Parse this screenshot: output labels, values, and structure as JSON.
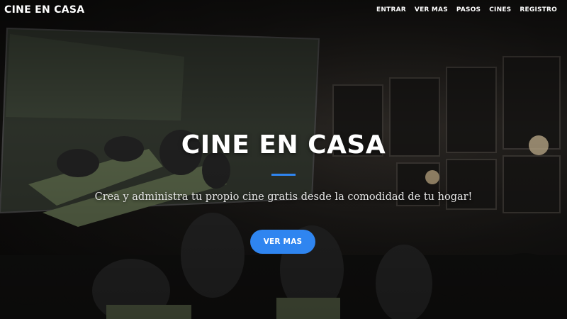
{
  "navbar": {
    "brand": "CINE EN CASA",
    "links": [
      "ENTRAR",
      "VER MAS",
      "PASOS",
      "CINES",
      "REGISTRO"
    ]
  },
  "hero": {
    "title": "CINE EN CASA",
    "subtitle": "Crea y administra tu propio cine gratis desde la comodidad de tu hogar!",
    "cta_label": "VER MAS"
  },
  "colors": {
    "accent": "#2f85f0",
    "text": "#ffffff"
  }
}
